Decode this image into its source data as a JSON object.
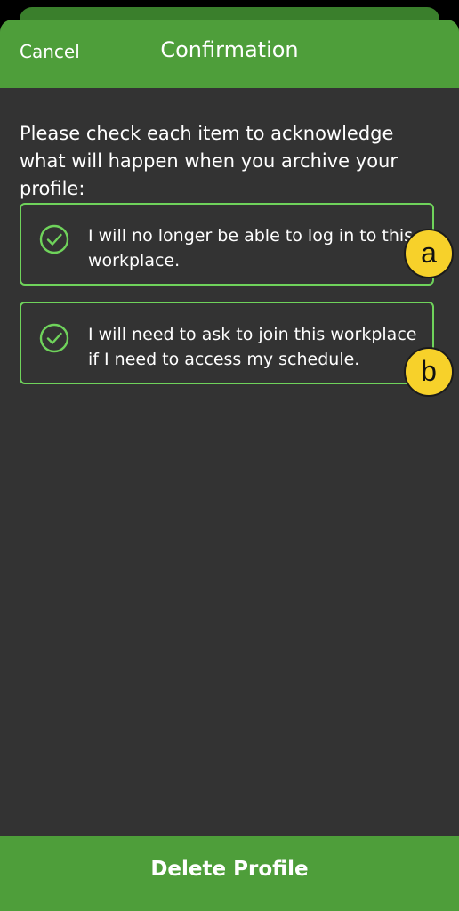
{
  "header": {
    "cancel_label": "Cancel",
    "title": "Confirmation"
  },
  "intro_text": "Please check each item to acknowledge what will happen when you archive your profile:",
  "items": [
    {
      "text": "I will no longer be able to log in to this workplace.",
      "checked": true,
      "badge": "a"
    },
    {
      "text": "I will need to ask to join this workplace if I need to access my schedule.",
      "checked": true,
      "badge": "b"
    }
  ],
  "footer": {
    "delete_label": "Delete Profile"
  },
  "icons": {
    "check": "check-circle-icon"
  },
  "colors": {
    "brand_green": "#4e9e3a",
    "check_green": "#6fd35b",
    "background": "#333333",
    "badge_yellow": "#f7d12a"
  }
}
